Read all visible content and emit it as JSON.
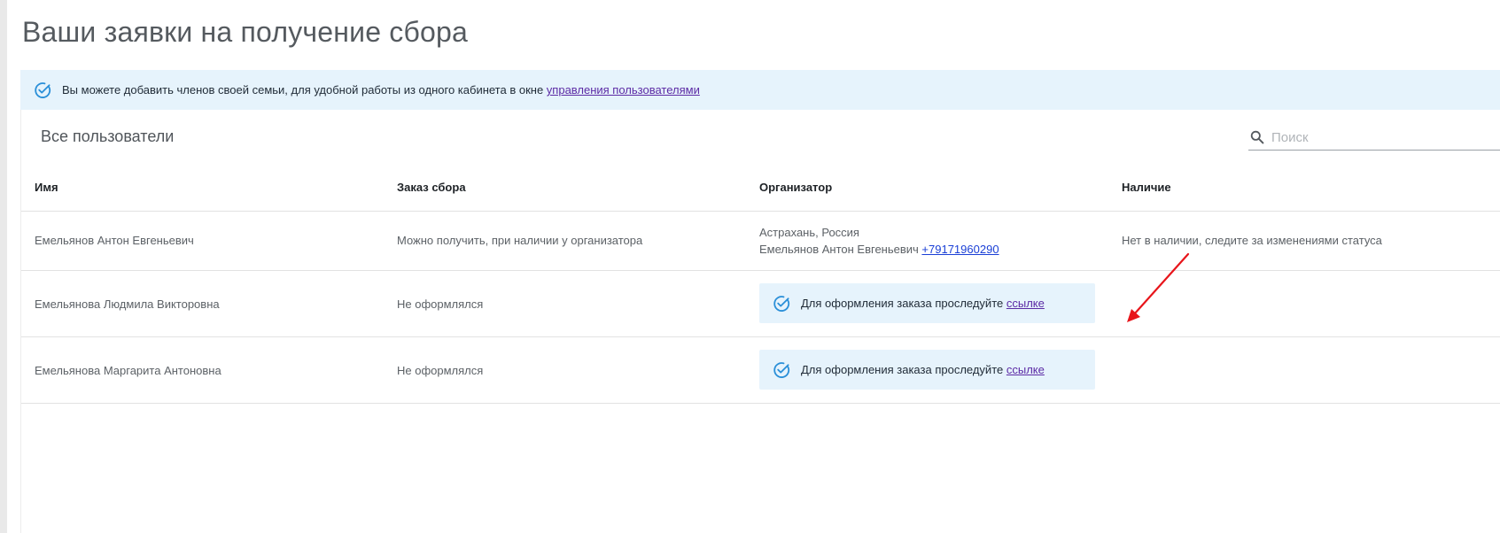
{
  "page": {
    "title": "Ваши заявки на получение сбора"
  },
  "banner": {
    "icon": "check-circle-icon",
    "text": "Вы можете добавить членов своей семьи, для удобной работы из одного кабинета в окне ",
    "link_text": "управления пользователями"
  },
  "card": {
    "title": "Все пользователи",
    "search": {
      "placeholder": "Поиск",
      "value": "",
      "icon": "search-icon"
    }
  },
  "table": {
    "headers": {
      "name": "Имя",
      "order": "Заказ сбора",
      "organizer": "Организатор",
      "availability": "Наличие"
    },
    "rows": [
      {
        "name": "Емельянов Антон Евгеньевич",
        "order": "Можно получить, при наличии у организатора",
        "organizer_location": "Астрахань, Россия",
        "organizer_name": "Емельянов Антон Евгеньевич ",
        "organizer_phone": "+79171960290",
        "availability": "Нет в наличии, следите за изменениями статуса"
      },
      {
        "name": "Емельянова Людмила Викторовна",
        "order": "Не оформлялся",
        "notice_text": "Для оформления заказа проследуйте ",
        "notice_link": "ссылке",
        "availability": ""
      },
      {
        "name": "Емельянова Маргарита Антоновна",
        "order": "Не оформлялся",
        "notice_text": "Для оформления заказа проследуйте ",
        "notice_link": "ссылке",
        "availability": ""
      }
    ]
  },
  "colors": {
    "banner_bg": "#e6f3fc",
    "link_visited": "#5b2aa5",
    "phone_link": "#1a3fd6",
    "icon_blue": "#2a8fd8",
    "annotation_arrow": "#e8151b"
  }
}
